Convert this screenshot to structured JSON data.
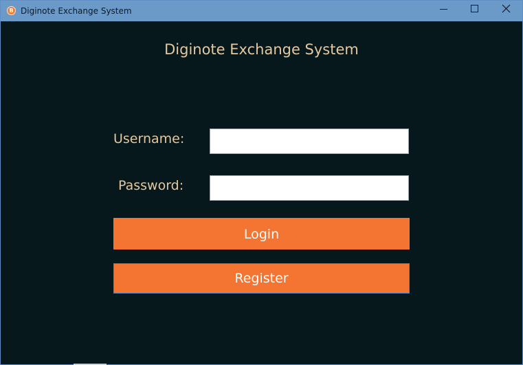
{
  "window": {
    "title": "Diginote Exchange System",
    "app_icon_glyph": "B",
    "icons": {
      "app": "app-logo-icon",
      "minimize": "minimize-icon",
      "maximize": "maximize-icon",
      "close": "close-icon"
    }
  },
  "form": {
    "heading": "Diginote Exchange System",
    "username_label": "Username:",
    "username_value": "",
    "password_label": "Password:",
    "password_value": "",
    "login_label": "Login",
    "register_label": "Register"
  },
  "colors": {
    "background": "#06181c",
    "titlebar": "#6c9ac8",
    "label_text": "#e3c9a1",
    "button": "#f47431",
    "button_text": "#ffffff",
    "focus_border": "#4a86c5"
  }
}
